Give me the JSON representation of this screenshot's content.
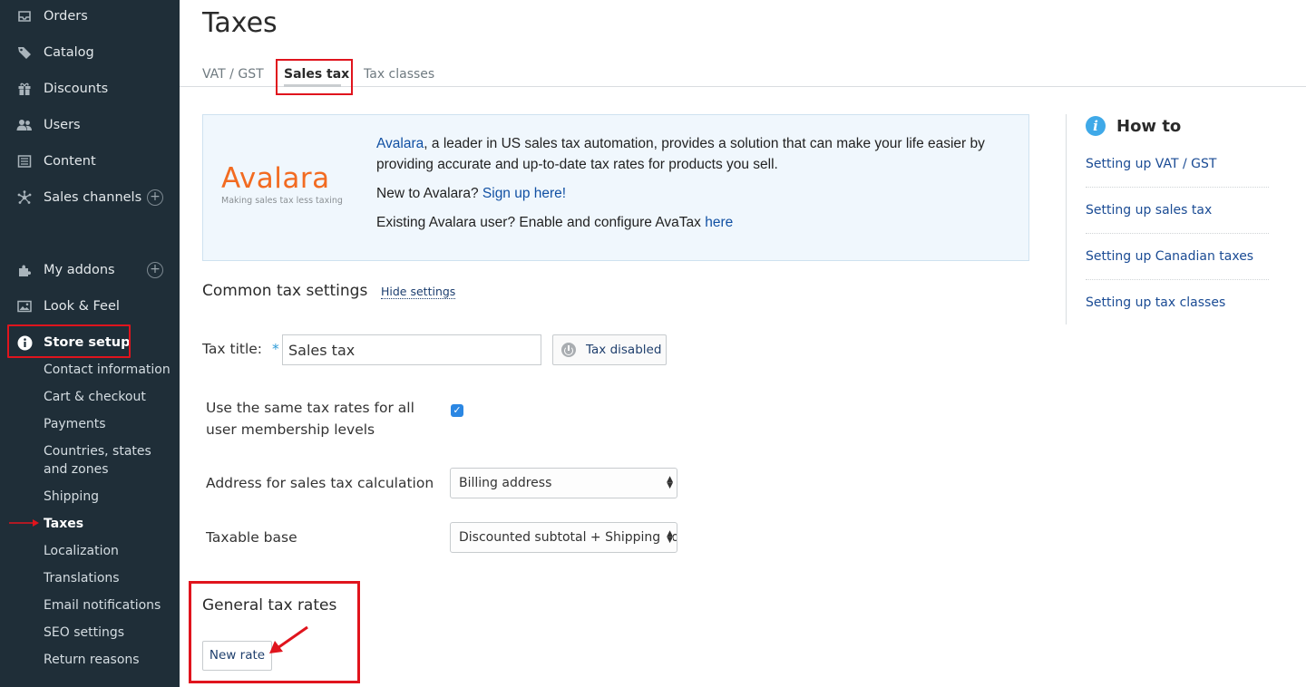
{
  "sidebar": {
    "items": [
      {
        "label": "Orders",
        "icon": "inbox-icon"
      },
      {
        "label": "Catalog",
        "icon": "tag-icon"
      },
      {
        "label": "Discounts",
        "icon": "gift-icon"
      },
      {
        "label": "Users",
        "icon": "users-icon"
      },
      {
        "label": "Content",
        "icon": "document-icon"
      },
      {
        "label": "Sales channels",
        "icon": "network-icon"
      },
      {
        "label": "My addons",
        "icon": "puzzle-icon"
      },
      {
        "label": "Look & Feel",
        "icon": "image-icon"
      },
      {
        "label": "Store setup",
        "icon": "info-icon"
      }
    ],
    "store_setup_subitems": [
      "Contact information",
      "Cart & checkout",
      "Payments",
      "Countries, states and zones",
      "Shipping",
      "Taxes",
      "Localization",
      "Translations",
      "Email notifications",
      "SEO settings",
      "Return reasons"
    ]
  },
  "page": {
    "title": "Taxes",
    "tabs": [
      "VAT / GST",
      "Sales tax",
      "Tax classes"
    ],
    "active_tab": "Sales tax"
  },
  "promo": {
    "logo_wordmark": "Avalara",
    "logo_tagline": "Making sales tax less taxing",
    "line1_link": "Avalara",
    "line1_rest": ", a leader in US sales tax automation, provides a solution that can make your life easier by providing accurate and up-to-date tax rates for products you sell.",
    "line2_text": "New to Avalara? ",
    "line2_link": "Sign up here!",
    "line3_text": "Existing Avalara user? Enable and configure AvaTax ",
    "line3_link": "here"
  },
  "settings": {
    "section_title": "Common tax settings",
    "hide_link": "Hide settings",
    "tax_title_label": "Tax title:",
    "required_mark": "*",
    "tax_title_value": "Sales tax",
    "tax_status_button": "Tax disabled",
    "same_rates_label": "Use the same tax rates for all user membership levels",
    "same_rates_checked": true,
    "address_label": "Address for sales tax calculation",
    "address_value": "Billing address",
    "taxable_base_label": "Taxable base",
    "taxable_base_value": "Discounted subtotal + Shipping cost"
  },
  "rates": {
    "section_title": "General tax rates",
    "new_rate_button": "New rate"
  },
  "howto": {
    "title": "How to",
    "links": [
      "Setting up VAT / GST",
      "Setting up sales tax",
      "Setting up Canadian taxes",
      "Setting up tax classes"
    ]
  },
  "colors": {
    "sidebar_bg": "#1f2e38",
    "highlight_red": "#e0141d",
    "link_blue": "#1150a3",
    "avalara_orange": "#f26b21"
  }
}
